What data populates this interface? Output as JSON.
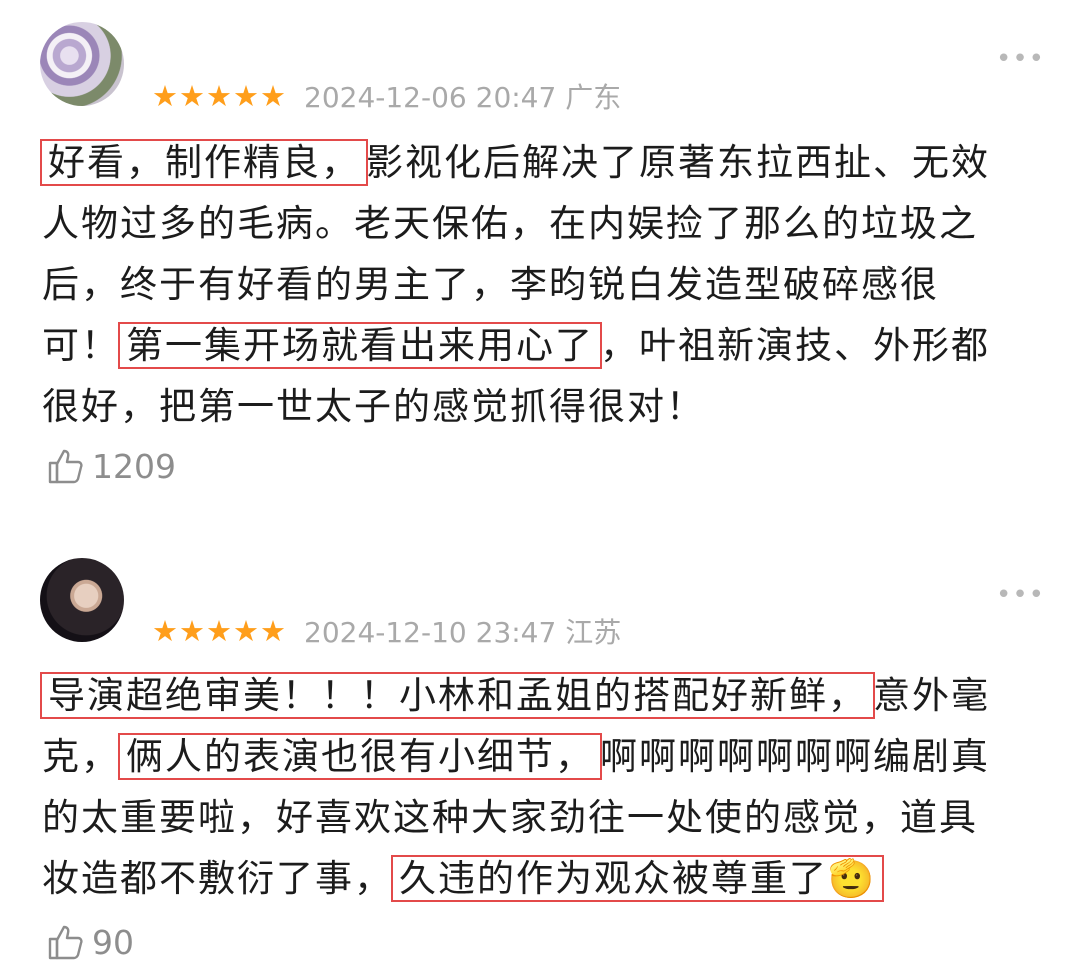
{
  "reviews": [
    {
      "star_count": 5,
      "date": "2024-12-06 20:47",
      "location": "广东",
      "likes": "1209",
      "lines": [
        [
          {
            "t": "好看，制作精良，",
            "hl": true
          },
          {
            "t": "影视化后解决了原著东拉西扯、无效",
            "hl": false
          }
        ],
        [
          {
            "t": "人物过多的毛病。老天保佑，在内娱捡了那么的垃圾之",
            "hl": false
          }
        ],
        [
          {
            "t": "后，终于有好看的男主了，李昀锐白发造型破碎感很",
            "hl": false
          }
        ],
        [
          {
            "t": "可！",
            "hl": false
          },
          {
            "t": "第一集开场就看出来用心了",
            "hl": true
          },
          {
            "t": "，叶祖新演技、外形都",
            "hl": false
          }
        ],
        [
          {
            "t": "很好，把第一世太子的感觉抓得很对！",
            "hl": false
          }
        ]
      ]
    },
    {
      "star_count": 5,
      "date": "2024-12-10 23:47",
      "location": "江苏",
      "likes": "90",
      "lines": [
        [
          {
            "t": "导演超绝审美！！！小林和孟姐的搭配好新鲜，",
            "hl": true
          },
          {
            "t": "意外毫",
            "hl": false
          }
        ],
        [
          {
            "t": "克，",
            "hl": false
          },
          {
            "t": "俩人的表演也很有小细节，",
            "hl": true
          },
          {
            "t": "啊啊啊啊啊啊啊编剧真",
            "hl": false
          }
        ],
        [
          {
            "t": "的太重要啦，好喜欢这种大家劲往一处使的感觉，道具",
            "hl": false
          }
        ],
        [
          {
            "t": "妆造都不敷衍了事，",
            "hl": false
          },
          {
            "t": "久违的作为观众被尊重了🫡",
            "hl": true
          }
        ]
      ]
    }
  ],
  "more_label": "•••",
  "star_glyph": "★",
  "colors": {
    "star": "#ff9e1b",
    "highlight_border": "#e34a4a",
    "meta": "#a9a9a9"
  },
  "icons": {
    "avatar_1": "flower-avatar",
    "avatar_2": "woman-portrait-avatar",
    "like": "thumbs-up-icon",
    "more": "more-dots-icon"
  }
}
